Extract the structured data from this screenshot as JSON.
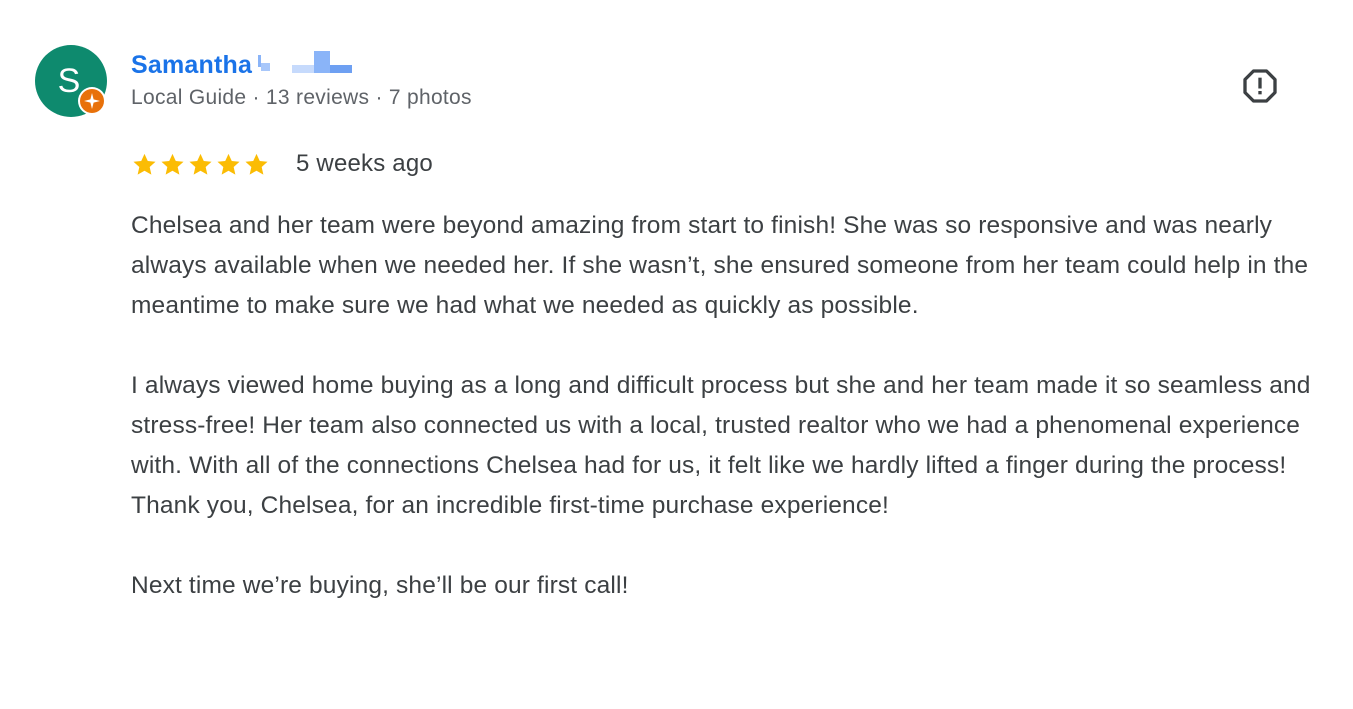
{
  "reviewer": {
    "initial": "S",
    "name": "Samantha",
    "meta": "Local Guide · 13 reviews · 7 photos",
    "avatar_color": "#0e8a6e",
    "badge_icon": "local-guide-star-icon"
  },
  "flag_icon": "report-flag-icon",
  "rating": {
    "stars": 5,
    "max": 5,
    "star_color": "#fbbc04",
    "date": "5 weeks ago"
  },
  "review": {
    "paragraphs": [
      "Chelsea and her team were beyond amazing from start to finish! She was so responsive and was nearly always available when we needed her. If she wasn’t, she ensured someone from her team could help in the meantime to make sure we had what we needed as quickly as possible.",
      "I always viewed home buying as a long and difficult process but she and her team made it so seamless and stress-free! Her team also connected us with a local, trusted realtor who we had a phenomenal experience with. With all of the connections Chelsea had for us, it felt like we hardly lifted a finger during the process! Thank you, Chelsea, for an incredible first-time purchase experience!",
      "Next time we’re buying, she’ll be our first call!"
    ]
  },
  "colors": {
    "link": "#1a73e8",
    "secondary_text": "#5f6368",
    "body_text": "#3c4043",
    "badge": "#e8710a"
  }
}
